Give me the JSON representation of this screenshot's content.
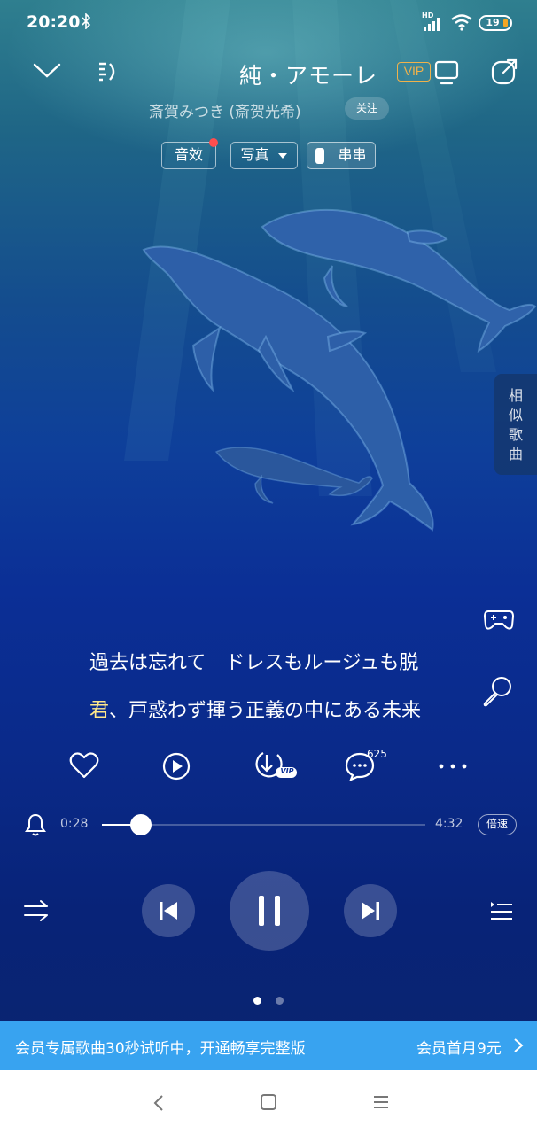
{
  "status_bar": {
    "time": "20:20",
    "network_label": "HD",
    "battery": "19"
  },
  "header": {
    "song_title": "純・アモーレ",
    "vip_badge": "VIP",
    "artist": "斎賀みつき (斎贺光希)",
    "follow_label": "关注"
  },
  "chips": {
    "sound_effect": "音效",
    "photo": "写真",
    "chuanchuan": "串串"
  },
  "side_tab": {
    "chars": [
      "相",
      "似",
      "歌",
      "曲"
    ]
  },
  "lyrics": {
    "line1": "過去は忘れて　ドレスもルージュも脱",
    "line2_highlight": "君",
    "line2_rest": "、戸惑わず揮う正義の中にある未来"
  },
  "actions": {
    "comment_count": "625",
    "download_badge": "VIP"
  },
  "progress": {
    "current": "0:28",
    "total": "4:32",
    "fraction": 0.12,
    "speed_label": "倍速"
  },
  "pager": {
    "count": 2,
    "active": 0
  },
  "banner": {
    "left_text": "会员专属歌曲30秒试听中，开通畅享完整版",
    "right_text": "会员首月9元"
  },
  "colors": {
    "accent_yellow": "#ffe88a",
    "vip_gold": "#f0b24b",
    "banner_blue": "#38a3f0",
    "badge_red": "#ff4e4e"
  }
}
